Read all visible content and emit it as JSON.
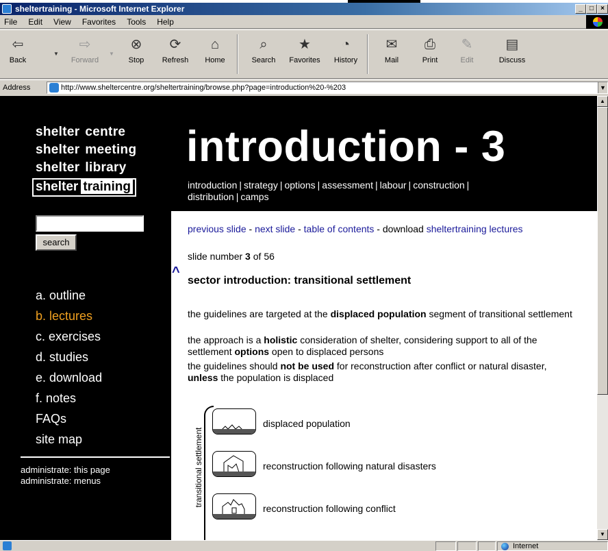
{
  "window": {
    "title": "sheltertraining - Microsoft Internet Explorer",
    "controls": [
      "_",
      "□",
      "×"
    ]
  },
  "menu": [
    "File",
    "Edit",
    "View",
    "Favorites",
    "Tools",
    "Help"
  ],
  "toolbar": {
    "back": "Back",
    "forward": "Forward",
    "stop": "Stop",
    "refresh": "Refresh",
    "home": "Home",
    "search": "Search",
    "favorites": "Favorites",
    "history": "History",
    "mail": "Mail",
    "print": "Print",
    "edit": "Edit",
    "discuss": "Discuss"
  },
  "address": {
    "label": "Address",
    "url": "http://www.sheltercentre.org/sheltertraining/browse.php?page=introduction%20-%203"
  },
  "site_nav": {
    "items": [
      {
        "w1": "shelter",
        "w2": "centre"
      },
      {
        "w1": "shelter",
        "w2": "meeting"
      },
      {
        "w1": "shelter",
        "w2": "library"
      }
    ],
    "active": {
      "w1": "shelter",
      "w2": "training"
    }
  },
  "search": {
    "value": "",
    "button": "search"
  },
  "section_nav": {
    "items": [
      {
        "label": "a. outline",
        "active": false
      },
      {
        "label": "b. lectures",
        "active": true
      },
      {
        "label": "c. exercises",
        "active": false
      },
      {
        "label": "d. studies",
        "active": false
      },
      {
        "label": "e. download",
        "active": false
      },
      {
        "label": "f. notes",
        "active": false
      },
      {
        "label": "FAQs",
        "active": false
      },
      {
        "label": "site map",
        "active": false
      }
    ],
    "active_color": "#f0a020"
  },
  "admin": {
    "page": "administrate: this page",
    "menus": "administrate: menus"
  },
  "heading": "introduction - 3",
  "top_nav": {
    "items": [
      "introduction",
      "strategy",
      "options",
      "assessment",
      "labour",
      "construction",
      "distribution",
      "camps"
    ],
    "separator": "|"
  },
  "slide_nav": {
    "previous": "previous slide",
    "next": "next slide",
    "toc": "table of contents",
    "download_text": "download",
    "download_link": "sheltertraining lectures",
    "dash": " - "
  },
  "slide_count": {
    "prefix": "slide number",
    "current": "3",
    "of": "of",
    "total": "56"
  },
  "caret": "^",
  "slide_title": "sector introduction: transitional settlement",
  "paragraphs": {
    "p1": {
      "a": "the guidelines are targeted at the ",
      "b": "displaced population",
      "c": " segment of transitional settlement"
    },
    "p2": {
      "a": "the approach is a ",
      "b": "holistic",
      "c": " consideration of shelter, considering support to all of the settlement ",
      "d": "options",
      "e": " open to displaced persons"
    },
    "p3": {
      "a": "the guidelines should ",
      "b": "not be used",
      "c": " for reconstruction after conflict or natural disaster, ",
      "d": "unless",
      "e": " the population is displaced"
    }
  },
  "diagram": {
    "vertical_label": "transitional settlement",
    "rows": [
      {
        "label": "displaced population",
        "icon": "tents-icon"
      },
      {
        "label": "reconstruction following natural disasters",
        "icon": "damaged-house-icon"
      },
      {
        "label": "reconstruction following conflict",
        "icon": "ruined-house-icon"
      }
    ]
  },
  "status": {
    "zone": "Internet"
  },
  "colors": {
    "link": "#1a1a9a",
    "page_bg": "#000000",
    "active_nav": "#f0a020",
    "titlebar": "#0a246a"
  }
}
